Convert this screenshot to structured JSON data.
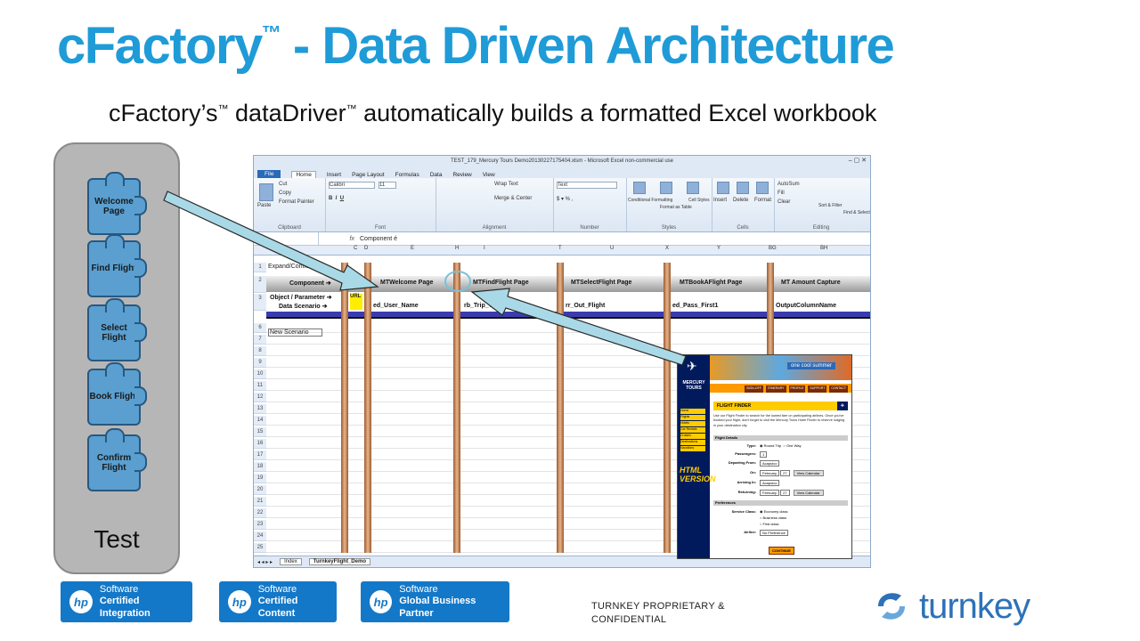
{
  "title": {
    "text": "cFactory",
    "tm": "™",
    "rest": " - Data Driven Architecture"
  },
  "subtitle": {
    "part1": "cFactory’s",
    "tm1": "™",
    "part2": " dataDriver",
    "tm2": "™",
    "part3": " automatically builds a formatted Excel workbook"
  },
  "test_panel": {
    "label": "Test",
    "steps": [
      {
        "label": "Welcome Page"
      },
      {
        "label": "Find Flight"
      },
      {
        "label": "Select Flight"
      },
      {
        "label": "Book Flight"
      },
      {
        "label": "Confirm Flight"
      }
    ]
  },
  "excel": {
    "window_title": "TEST_179_Mercury Tours Demo20130227175404.xlsm - Microsoft Excel non-commercial use",
    "tabs": [
      "File",
      "Home",
      "Insert",
      "Page Layout",
      "Formulas",
      "Data",
      "Review",
      "View"
    ],
    "active_tab": "Home",
    "ribbon": {
      "font_name": "Calibri",
      "font_size": "11",
      "number_format": "Text",
      "wrap_text": "Wrap Text",
      "merge_center": "Merge & Center",
      "cut": "Cut",
      "copy": "Copy",
      "format_painter": "Format Painter",
      "paste": "Paste",
      "conditional": "Conditional Formatting",
      "format_table": "Format as Table",
      "cell_styles": "Cell Styles",
      "insert": "Insert",
      "delete": "Delete",
      "format": "Format",
      "autosum": "AutoSum",
      "fill": "Fill",
      "clear": "Clear",
      "sort": "Sort & Filter",
      "find": "Find & Select",
      "groups": [
        "Clipboard",
        "Font",
        "Alignment",
        "Number",
        "Styles",
        "Cells",
        "Editing"
      ]
    },
    "formula_bar": {
      "fx": "fx",
      "value": "Component é"
    },
    "columns": [
      "C",
      "D",
      "E",
      "H",
      "I",
      "T",
      "U",
      "X",
      "Y",
      "BG",
      "BH"
    ],
    "row1": "Expand/Contract All",
    "component_label": "Component ➔",
    "object_label": "Object / Parameter ➔",
    "scenario_label": "Data Scenario ➔",
    "url_label": "URL",
    "components": [
      "MTWelcome Page",
      "MTFindFlight Page",
      "MTSelectFlight Page",
      "MTBookAFlight Page",
      "MT Amount Capture"
    ],
    "params": [
      "ed_User_Name",
      "rb_Trip_Type",
      "rr_Out_Flight",
      "ed_Pass_First1",
      "OutputColumnName"
    ],
    "new_scenario": "New Scenario",
    "row_numbers": [
      "1",
      "2",
      "3",
      "6",
      "7",
      "8",
      "9",
      "10",
      "11",
      "12",
      "13",
      "14",
      "15",
      "16",
      "17",
      "18",
      "19",
      "20",
      "21",
      "22",
      "23",
      "24",
      "25",
      "26"
    ],
    "sheet_tabs": [
      "Index",
      "TurnkeyFlight_Demo"
    ]
  },
  "mercury": {
    "banner": "one cool summer",
    "brand": "MERCURY TOURS",
    "menu": [
      "SIGN-OFF",
      "ITINERARY",
      "PROFILE",
      "SUPPORT",
      "CONTACT"
    ],
    "nav": [
      "Home",
      "Flights",
      "Hotels",
      "Car Rentals",
      "Cruises",
      "Destinations",
      "Vacations"
    ],
    "html_badge": "HTML VERSION",
    "finder_title": "FLIGHT FINDER",
    "intro": "Use our Flight Finder to search for the lowest fare on participating airlines. Once you've booked your flight, don't forget to visit the Mercury Tours Hotel Finder to reserve lodging in your destination city.",
    "flight_details": "Flight Details",
    "type_label": "Type:",
    "type_round": "Round Trip",
    "type_one": "One Way",
    "passengers_label": "Passengers:",
    "passengers": "1",
    "departing_label": "Departing From:",
    "departing": "Acapulco",
    "on_label": "On:",
    "on_month": "February",
    "on_day": "27",
    "arriving_label": "Arriving In:",
    "arriving": "Acapulco",
    "returning_label": "Returning:",
    "ret_month": "February",
    "ret_day": "27",
    "view_calendar": "View Calendar",
    "preferences": "Preferences",
    "class_label": "Service Class:",
    "class1": "Economy class",
    "class2": "Business class",
    "class3": "First class",
    "airline_label": "Airline:",
    "airline": "No Preference",
    "continue": "CONTINUE"
  },
  "footer": {
    "badges": [
      {
        "line1": "Software",
        "line2": "Certified Integration"
      },
      {
        "line1": "Software",
        "line2": "Certified Content"
      },
      {
        "line1": "Software",
        "line2": "Global Business Partner"
      }
    ],
    "hp": "hp",
    "confidential_line1": "TURNKEY PROPRIETARY &",
    "confidential_line2": "CONFIDENTIAL",
    "logo_word": "turnkey"
  },
  "colors": {
    "title": "#1f9bd7",
    "puzzle": "#5a9fd0",
    "arrow": "#a9d9e6",
    "badge": "#1478c8"
  }
}
